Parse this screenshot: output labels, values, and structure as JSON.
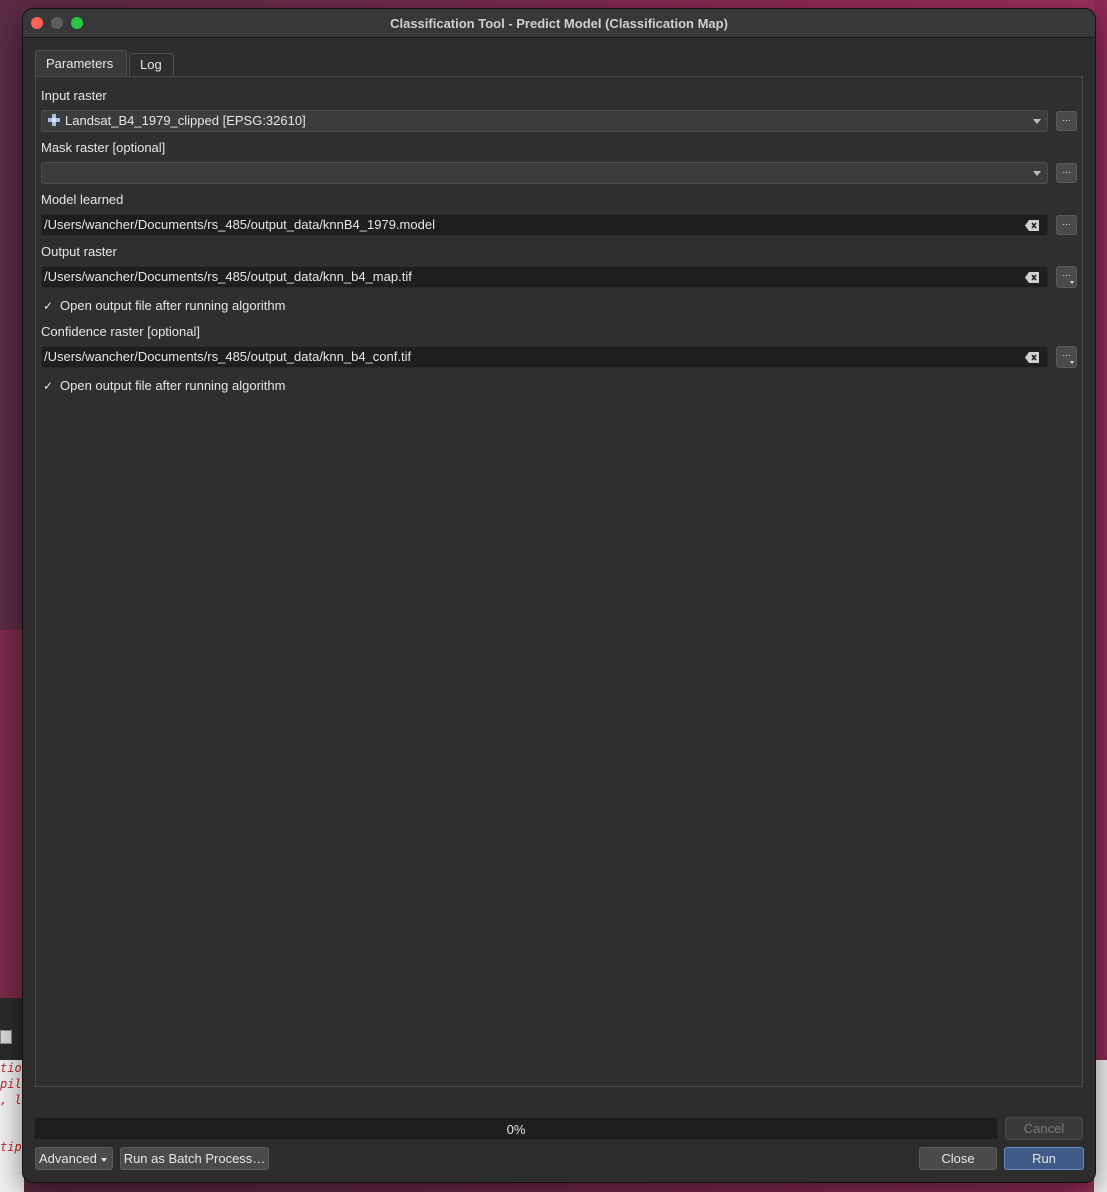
{
  "window": {
    "title": "Classification Tool - Predict Model (Classification Map)"
  },
  "tabs": [
    {
      "label": "Parameters",
      "active": true
    },
    {
      "label": "Log",
      "active": false
    }
  ],
  "params": {
    "input_raster": {
      "label": "Input raster",
      "value": "Landsat_B4_1979_clipped [EPSG:32610]",
      "icon": "raster-layer-icon"
    },
    "mask_raster": {
      "label": "Mask raster [optional]",
      "value": ""
    },
    "model_learned": {
      "label": "Model learned",
      "value": "/Users/wancher/Documents/rs_485/output_data/knnB4_1979.model"
    },
    "output_raster": {
      "label": "Output raster",
      "value": "/Users/wancher/Documents/rs_485/output_data/knn_b4_map.tif",
      "open_after_label": "Open output file after running algorithm",
      "open_after_checked": true
    },
    "confidence_raster": {
      "label": "Confidence raster [optional]",
      "value": "/Users/wancher/Documents/rs_485/output_data/knn_b4_conf.tif",
      "open_after_label": "Open output file after running algorithm",
      "open_after_checked": true
    },
    "browse_label": "...",
    "check_mark": "✓"
  },
  "progress": {
    "text": "0%",
    "value": 0
  },
  "buttons": {
    "cancel": "Cancel",
    "advanced": "Advanced",
    "batch": "Run as Batch Process…",
    "close": "Close",
    "run": "Run"
  },
  "background": {
    "code_lines": [
      "tio",
      "pil",
      ", l",
      "tip"
    ]
  },
  "colors": {
    "window_bg": "#2d2d2d",
    "field_bg": "#1e1e1e",
    "run_accent": "#6a8cc8",
    "close_dot": "#ff5f57",
    "max_dot": "#28c840"
  }
}
